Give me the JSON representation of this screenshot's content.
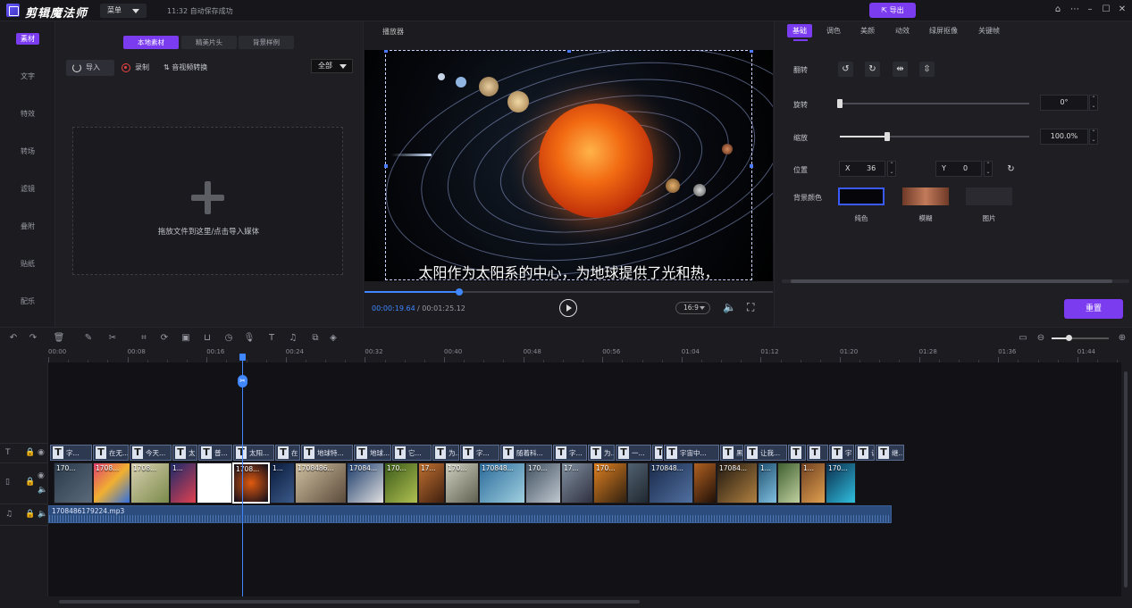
{
  "app": {
    "title": "剪辑魔法师",
    "menu_label": "菜单",
    "save_status": "11:32 自动保存成功",
    "export_label": "导出"
  },
  "sidebar": {
    "items": [
      {
        "label": "素材",
        "active": true
      },
      {
        "label": "文字"
      },
      {
        "label": "特效"
      },
      {
        "label": "转场"
      },
      {
        "label": "滤镜"
      },
      {
        "label": "叠附"
      },
      {
        "label": "贴纸"
      },
      {
        "label": "配乐"
      }
    ]
  },
  "media": {
    "tabs": [
      "本地素材",
      "精美片头",
      "背景样例"
    ],
    "import_label": "导入",
    "record_label": "录制",
    "convert_label": "音视频转换",
    "filter_value": "全部",
    "drop_text": "拖放文件到这里/点击导入媒体"
  },
  "player": {
    "title": "播放器",
    "subtitle": "太阳作为太阳系的中心，为地球提供了光和热，",
    "current_time": "00:00:19.64",
    "total_time": "/ 00:01:25.12",
    "progress": 0.232,
    "aspect_ratio": "16:9"
  },
  "props": {
    "tabs": [
      "基础",
      "调色",
      "美颜",
      "动效",
      "绿屏抠像",
      "关键帧"
    ],
    "flip_label": "翻转",
    "rotate_label": "旋转",
    "rotate_value": "0°",
    "rotate_fraction": 0.0,
    "scale_label": "缩放",
    "scale_value": "100.0%",
    "scale_fraction": 0.25,
    "position_label": "位置",
    "pos_x_label": "X",
    "pos_x": "36",
    "pos_y_label": "Y",
    "pos_y": "0",
    "bg_label": "背景颜色",
    "bg_options": [
      "纯色",
      "模糊",
      "图片"
    ],
    "reset_label": "重置"
  },
  "timeline": {
    "ruler": [
      "00:00",
      "00:08",
      "00:16",
      "00:24",
      "00:32",
      "00:40",
      "00:48",
      "00:56",
      "01:04",
      "01:12",
      "01:20",
      "01:28",
      "01:36",
      "01:44"
    ],
    "text_clips": [
      {
        "label": "字..."
      },
      {
        "label": "在无..."
      },
      {
        "label": "今天..."
      },
      {
        "label": "太"
      },
      {
        "label": "普..."
      },
      {
        "label": "太阳..."
      },
      {
        "label": "在"
      },
      {
        "label": "地球特..."
      },
      {
        "label": "地球..."
      },
      {
        "label": "它..."
      },
      {
        "label": "为..."
      },
      {
        "label": "字..."
      },
      {
        "label": "随着科..."
      },
      {
        "label": "字..."
      },
      {
        "label": "为..."
      },
      {
        "label": "一..."
      },
      {
        "label": "宇"
      },
      {
        "label": "宇宙中..."
      },
      {
        "label": "黑"
      },
      {
        "label": "让我..."
      },
      {
        "label": ""
      },
      {
        "label": ""
      },
      {
        "label": "宇"
      },
      {
        "label": "让"
      },
      {
        "label": "继..."
      }
    ],
    "video_clips": [
      {
        "label": "170..."
      },
      {
        "label": "1708..."
      },
      {
        "label": "1708..."
      },
      {
        "label": "1..."
      },
      {
        "label": ""
      },
      {
        "label": "1708..."
      },
      {
        "label": "1..."
      },
      {
        "label": "1708486..."
      },
      {
        "label": "17084..."
      },
      {
        "label": "170..."
      },
      {
        "label": "17..."
      },
      {
        "label": "170..."
      },
      {
        "label": "170848..."
      },
      {
        "label": "170..."
      },
      {
        "label": "17..."
      },
      {
        "label": "170..."
      },
      {
        "label": ""
      },
      {
        "label": "170848..."
      },
      {
        "label": ""
      },
      {
        "label": "17084..."
      },
      {
        "label": "1..."
      },
      {
        "label": ""
      },
      {
        "label": "1..."
      },
      {
        "label": "170..."
      }
    ],
    "audio_label": "1708486179224.mp3"
  }
}
